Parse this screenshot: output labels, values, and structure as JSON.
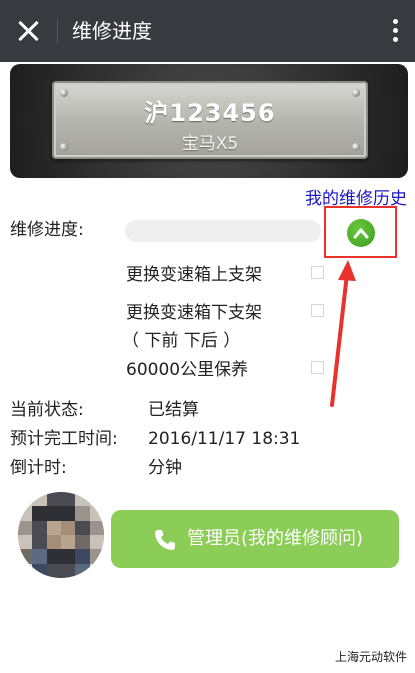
{
  "header": {
    "title": "维修进度"
  },
  "plate": {
    "number": "沪123456",
    "model": "宝马X5"
  },
  "history_link": "我的维修历史",
  "progress": {
    "label": "维修进度:",
    "value": 0
  },
  "items": [
    {
      "text": "更换变速箱上支架",
      "checked": false
    },
    {
      "text": "更换变速箱下支架",
      "sub": "（ 下前 下后 ）",
      "checked": false
    },
    {
      "text": "60000公里保养",
      "checked": false
    }
  ],
  "status": {
    "current_label": "当前状态:",
    "current_value": "已结算",
    "eta_label": "预计完工时间:",
    "eta_value": "2016/11/17 18:31",
    "countdown_label": "倒计时:",
    "countdown_value": "分钟"
  },
  "admin_button": {
    "label": "管理员(我的维修顾问)",
    "icon": "phone-icon"
  },
  "footer": "上海元动软件",
  "colors": {
    "header": "#393a3f",
    "accent_green": "#8bcd56",
    "link_blue": "#1a16c8",
    "highlight_red": "#e8322b"
  }
}
